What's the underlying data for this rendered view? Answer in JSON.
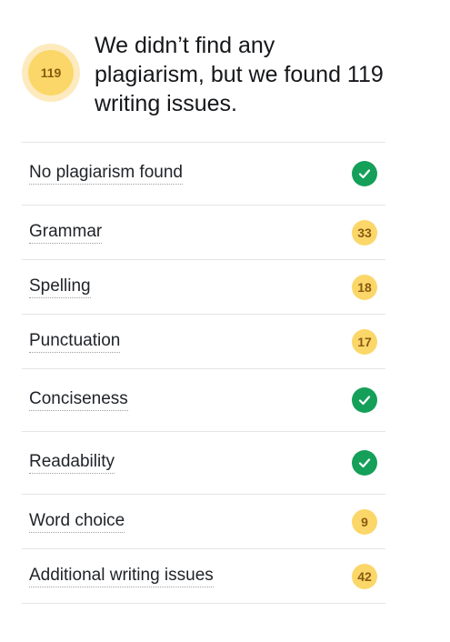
{
  "summary": {
    "score": "119",
    "headline": "We didn’t find any plagiarism, but we found 119 writing issues."
  },
  "colors": {
    "badge_fill": "#fbd76a",
    "badge_halo": "#fdebbf",
    "badge_text": "#8a5a10",
    "check_green": "#15a05a",
    "divider": "#e3e5e8"
  },
  "checks": [
    {
      "label": "No plagiarism found",
      "status": "pass",
      "count": null,
      "icon": "check-circle-icon"
    },
    {
      "label": "Grammar",
      "status": "issues",
      "count": "33"
    },
    {
      "label": "Spelling",
      "status": "issues",
      "count": "18"
    },
    {
      "label": "Punctuation",
      "status": "issues",
      "count": "17"
    },
    {
      "label": "Conciseness",
      "status": "pass",
      "count": null,
      "icon": "check-circle-icon"
    },
    {
      "label": "Readability",
      "status": "pass",
      "count": null,
      "icon": "check-circle-icon"
    },
    {
      "label": "Word choice",
      "status": "issues",
      "count": "9"
    },
    {
      "label": "Additional writing issues",
      "status": "issues",
      "count": "42"
    }
  ]
}
